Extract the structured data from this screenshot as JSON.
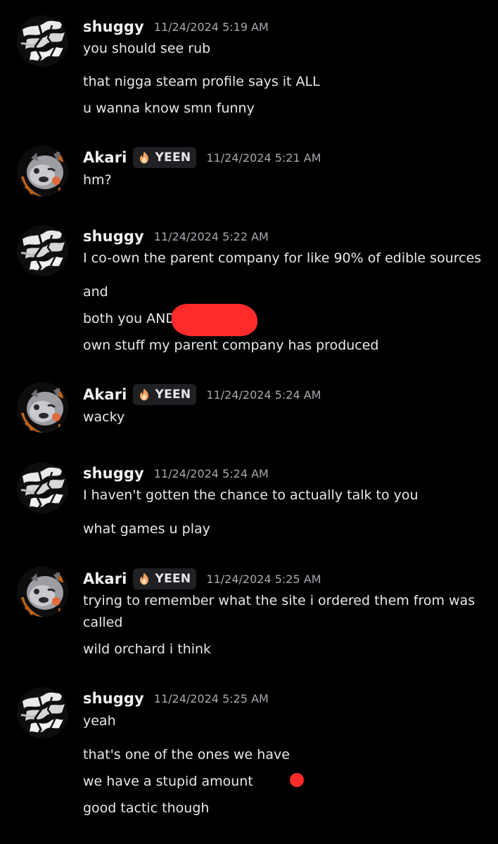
{
  "messages": [
    {
      "author": "shuggy",
      "timestamp": "11/24/2024 5:19 AM",
      "lines": [
        "you should see rub",
        "that nigga steam profile says it ALL",
        "u wanna know smn funny"
      ]
    },
    {
      "author": "Akari",
      "tag": "YEEN",
      "timestamp": "11/24/2024 5:21 AM",
      "lines": [
        "hm?"
      ]
    },
    {
      "author": "shuggy",
      "timestamp": "11/24/2024 5:22 AM",
      "lines": [
        "I co-own the parent company for like 90% of edible sources",
        "and",
        "both you AND",
        "own stuff my parent company has produced"
      ]
    },
    {
      "author": "Akari",
      "tag": "YEEN",
      "timestamp": "11/24/2024 5:24 AM",
      "lines": [
        "wacky"
      ]
    },
    {
      "author": "shuggy",
      "timestamp": "11/24/2024 5:24 AM",
      "lines": [
        "I haven't gotten the chance to actually talk to you",
        "what games u play"
      ]
    },
    {
      "author": "Akari",
      "tag": "YEEN",
      "timestamp": "11/24/2024 5:25 AM",
      "lines": [
        "trying to remember what the site i ordered them from was called",
        "wild orchard i think"
      ]
    },
    {
      "author": "shuggy",
      "timestamp": "11/24/2024 5:25 AM",
      "lines": [
        "yeah",
        "that's one of the ones we have",
        "we have a stupid amount",
        "good tactic though"
      ]
    }
  ],
  "colors": {
    "background": "#000000",
    "text": "#e8e9ec",
    "timestamp": "#a7a9b0",
    "tag_background": "#1f2023",
    "redaction": "#ff2b2b"
  },
  "icons": {
    "shuggy_avatar": "abstract-black-white-avatar",
    "akari_avatar": "hyena-character-avatar",
    "tag_icon": "flame-icon"
  }
}
